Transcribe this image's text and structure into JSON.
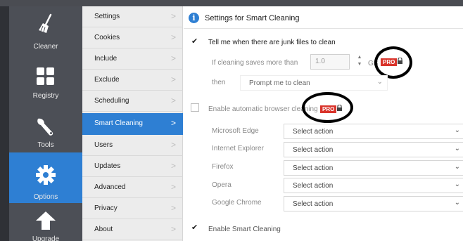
{
  "nav": {
    "items": [
      {
        "label": "Cleaner",
        "icon": "broom-icon"
      },
      {
        "label": "Registry",
        "icon": "registry-grid-icon"
      },
      {
        "label": "Tools",
        "icon": "wrench-icon"
      },
      {
        "label": "Options",
        "icon": "gear-icon"
      },
      {
        "label": "Upgrade",
        "icon": "upgrade-arrow-icon"
      }
    ]
  },
  "submenu": {
    "items": [
      {
        "label": "Settings"
      },
      {
        "label": "Cookies"
      },
      {
        "label": "Include"
      },
      {
        "label": "Exclude"
      },
      {
        "label": "Scheduling"
      },
      {
        "label": "Smart Cleaning"
      },
      {
        "label": "Users"
      },
      {
        "label": "Updates"
      },
      {
        "label": "Advanced"
      },
      {
        "label": "Privacy"
      },
      {
        "label": "About"
      }
    ],
    "chevron": ">"
  },
  "content": {
    "title": "Settings for Smart Cleaning",
    "info_glyph": "i",
    "junk_label": "Tell me when there are junk files to clean",
    "if_label": "If cleaning saves more than",
    "threshold_value": "1.0",
    "threshold_unit": "GB",
    "pro_badge": "PRO",
    "then_label": "then",
    "then_select": "Prompt me to clean",
    "auto_label": "Enable automatic browser cleaning",
    "browsers": [
      {
        "name": "Microsoft Edge",
        "action": "Select action"
      },
      {
        "name": "Internet Explorer",
        "action": "Select action"
      },
      {
        "name": "Firefox",
        "action": "Select action"
      },
      {
        "name": "Opera",
        "action": "Select action"
      },
      {
        "name": "Google Chrome",
        "action": "Select action"
      }
    ],
    "smart_label": "Enable Smart Cleaning"
  },
  "colors": {
    "accent": "#2e7fd3",
    "pro": "#d9342b",
    "nav_bg": "#4c4f56"
  }
}
